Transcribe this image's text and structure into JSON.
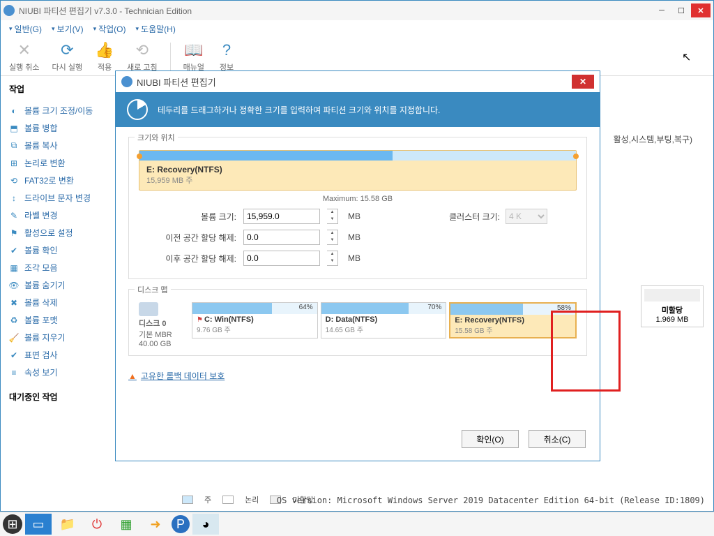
{
  "window": {
    "title": "NIUBI 파티션 편집기 v7.3.0 - Technician Edition"
  },
  "menu": {
    "general": "일반(G)",
    "view": "보기(V)",
    "work": "작업(O)",
    "help": "도움말(H)"
  },
  "toolbar": {
    "undo": "실행 취소",
    "redo": "다시 실행",
    "apply": "적용",
    "new": "새로 고침",
    "manual": "매뉴얼",
    "info": "정보"
  },
  "sidebar": {
    "heading": "작업",
    "items": [
      "볼륨 크기 조정/이동",
      "볼륨 병합",
      "볼륨 복사",
      "논리로 변환",
      "FAT32로 변환",
      "드라이브 문자 변경",
      "라벨 변경",
      "활성으로 설정",
      "볼륨 확인",
      "조각 모음",
      "볼륨 숨기기",
      "볼륨 삭제",
      "볼륨 포맷",
      "볼륨 지우기",
      "표면 검사",
      "속성 보기"
    ],
    "pending": "대기중인 작업"
  },
  "bg": {
    "flags": "활성,시스템,부팅,복구)",
    "unalloc_label": "미할당",
    "unalloc_size": "1.969 MB"
  },
  "dialog": {
    "title": "NIUBI 파티션 편집기",
    "banner": "테두리를 드래그하거나 정확한 크기를 입력하여 파티션 크기와 위치를 지정합니다.",
    "size_pos_label": "크기와 위치",
    "partition_name": "E: Recovery(NTFS)",
    "partition_size": "15,959 MB 주",
    "maximum": "Maximum: 15.58 GB",
    "vol_size_label": "볼륨 크기:",
    "vol_size_value": "15,959.0",
    "before_label": "이전 공간 할당 해제:",
    "before_value": "0.0",
    "after_label": "이후 공간 할당 해제:",
    "after_value": "0.0",
    "unit": "MB",
    "cluster_label": "클러스터 크기:",
    "cluster_value": "4 K",
    "disk_map_label": "디스크 맵",
    "disk_label": "디스크 0",
    "disk_type": "기본 MBR",
    "disk_size": "40.00 GB",
    "parts": [
      {
        "pct": "64%",
        "name": "C: Win(NTFS)",
        "size": "9.76 GB 주",
        "flag": true
      },
      {
        "pct": "70%",
        "name": "D: Data(NTFS)",
        "size": "14.65 GB 주",
        "flag": false
      },
      {
        "pct": "58%",
        "name": "E: Recovery(NTFS)",
        "size": "15.58 GB 주",
        "flag": false
      }
    ],
    "rollback": "고유한 롤백 데이터 보호",
    "ok": "확인(O)",
    "cancel": "취소(C)"
  },
  "legend": {
    "primary": "주",
    "logical": "논리",
    "unalloc": "미할당"
  },
  "footer": {
    "os": "OS version: Microsoft Windows Server 2019 Datacenter Edition  64-bit  (Release ID:1809)"
  }
}
